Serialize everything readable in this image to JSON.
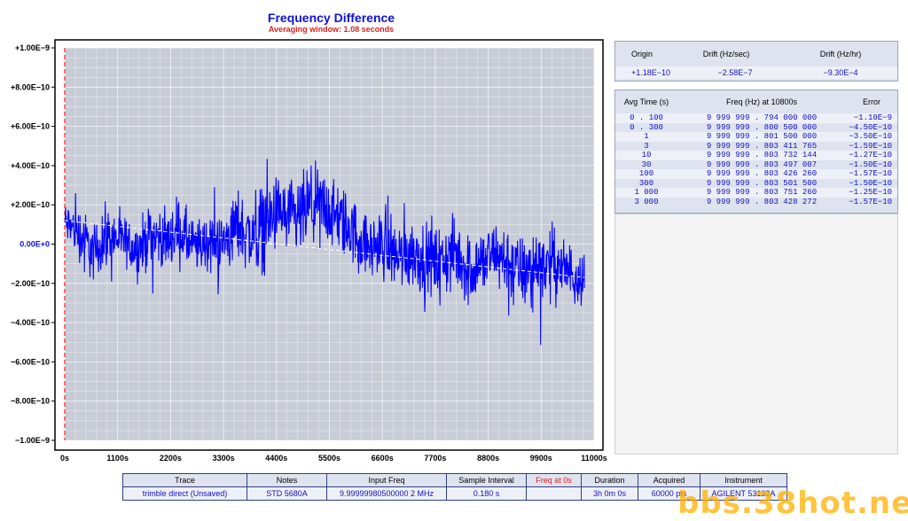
{
  "chart_data": {
    "type": "line",
    "title": "Frequency Difference",
    "subtitle": "Averaging window: 1.08 seconds",
    "xlim": [
      0,
      11000
    ],
    "ylim": [
      -1e-09,
      1e-09
    ],
    "x_ticks": [
      "0s",
      "1100s",
      "2200s",
      "3300s",
      "4400s",
      "5500s",
      "6600s",
      "7700s",
      "8800s",
      "9900s",
      "11000s"
    ],
    "y_ticks": [
      "+1.00E−9",
      "+8.00E−10",
      "+6.00E−10",
      "+4.00E−10",
      "+2.00E−10",
      "0.00E+0",
      "−2.00E−10",
      "−4.00E−10",
      "−6.00E−10",
      "−8.00E−10",
      "−1.00E−9"
    ],
    "grid": true,
    "series": [
      {
        "color": "#0000ff",
        "x": [
          0,
          300,
          600,
          900,
          1200,
          1500,
          1800,
          2100,
          2400,
          2700,
          3000,
          3300,
          3600,
          3900,
          4200,
          4500,
          4800,
          5100,
          5400,
          5700,
          6000,
          6300,
          6600,
          6900,
          7200,
          7500,
          7800,
          8100,
          8400,
          8700,
          9000,
          9300,
          9600,
          9900,
          10200,
          10500,
          10800
        ],
        "y": [
          1.1e-10,
          6e-11,
          -5e-11,
          4e-11,
          2e-11,
          -3e-11,
          5e-11,
          2e-11,
          6e-11,
          -2e-11,
          1e-11,
          0,
          1e-10,
          3e-11,
          1.2e-10,
          1.6e-10,
          1.1e-10,
          1.9e-10,
          1.8e-10,
          1.2e-10,
          6e-11,
          -2e-11,
          0,
          -6e-11,
          -4e-11,
          -8e-11,
          -1e-10,
          -5e-11,
          -1.3e-10,
          -9e-11,
          -5e-11,
          -1.2e-10,
          -1.5e-10,
          -9e-11,
          -1.1e-10,
          -1.4e-10,
          -1.6e-10
        ],
        "amplitude": [
          1.5e-10,
          2e-10,
          2.2e-10,
          2e-10,
          1.8e-10,
          2e-10,
          2.2e-10,
          2e-10,
          2.4e-10,
          2e-10,
          2.2e-10,
          2.4e-10,
          2.6e-10,
          2.8e-10,
          3.2e-10,
          2.4e-10,
          3e-10,
          3e-10,
          2.6e-10,
          2.8e-10,
          2.4e-10,
          2.2e-10,
          2.6e-10,
          2.4e-10,
          2.8e-10,
          2.4e-10,
          2.6e-10,
          2.6e-10,
          2.8e-10,
          2.6e-10,
          2.4e-10,
          2.6e-10,
          2.6e-10,
          2.8e-10,
          2.4e-10,
          2.2e-10,
          2e-10
        ]
      },
      {
        "color": "#ffffff",
        "style": "dashed",
        "x": [
          0,
          10800
        ],
        "y": [
          1.2e-10,
          -1.7e-10
        ]
      }
    ]
  },
  "origin_table": {
    "headers": [
      "Origin",
      "Drift (Hz/sec)",
      "Drift (Hz/hr)"
    ],
    "values": [
      "+1.18E−10",
      "−2.58E−7",
      "−9.30E−4"
    ]
  },
  "avg_table": {
    "headers": [
      "Avg Time (s)",
      "Freq (Hz) at 10800s",
      "Error"
    ],
    "rows": [
      [
        "0 . 100",
        "9 999 999 . 794 000 000",
        "−1.10E−9"
      ],
      [
        "0 . 300",
        "9 999 999 . 800 500 000",
        "−4.50E−10"
      ],
      [
        "1",
        "9 999 999 . 801 500 000",
        "−3.50E−10"
      ],
      [
        "3",
        "9 999 999 . 803 411 765",
        "−1.59E−10"
      ],
      [
        "10",
        "9 999 999 . 803 732 144",
        "−1.27E−10"
      ],
      [
        "30",
        "9 999 999 . 803 497 007",
        "−1.50E−10"
      ],
      [
        "100",
        "9 999 999 . 803 426 260",
        "−1.57E−10"
      ],
      [
        "300",
        "9 999 999 . 803 501 500",
        "−1.50E−10"
      ],
      [
        "1 000",
        "9 999 999 . 803 751 260",
        "−1.25E−10"
      ],
      [
        "3 000",
        "9 999 999 . 803 428 272",
        "−1.57E−10"
      ]
    ]
  },
  "bottom_table": {
    "headers": [
      "Trace",
      "Notes",
      "Input Freq",
      "Sample Interval",
      "Freq at 0s",
      "Duration",
      "Acquired",
      "Instrument"
    ],
    "values": [
      "trimble direct (Unsaved)",
      "STD 5680A",
      "9.99999980500000 2 MHz",
      "0.180 s",
      "",
      "3h 0m 0s",
      "60000 pts",
      "AGILENT 53132A"
    ],
    "highlight_color": "#e02020"
  },
  "watermark": "bbs.38hot.net"
}
